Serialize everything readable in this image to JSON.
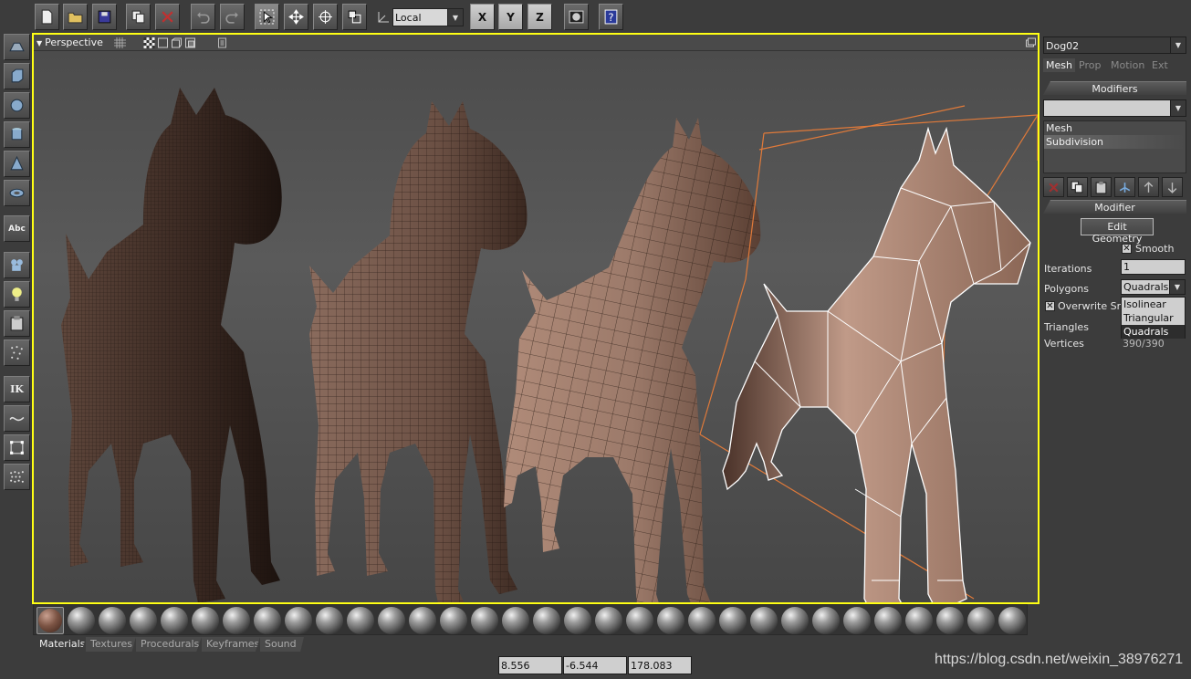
{
  "toolbar": {
    "coord_system": "Local",
    "axes": [
      "X",
      "Y",
      "Z"
    ],
    "buttons": [
      "new-file-icon",
      "open-folder-icon",
      "save-icon",
      "copy-icon",
      "delete-icon",
      "undo-icon",
      "redo-icon",
      "select-icon",
      "move-icon",
      "rotate-icon",
      "scale-icon",
      "render-icon",
      "help-icon"
    ]
  },
  "left_tools": {
    "text_tool": "Abc",
    "ik_tool": "IK"
  },
  "viewport": {
    "title": "Perspective",
    "border_color": "#ffff14"
  },
  "material_library": {
    "tabs": [
      "Materials",
      "Textures",
      "Procedurals",
      "Keyframes",
      "Sound"
    ],
    "active_tab": "Materials",
    "ball_count": 32
  },
  "status": {
    "x": "8.556",
    "y": "-6.544",
    "z": "178.083"
  },
  "watermark": "https://blog.csdn.net/weixin_38976271",
  "panel": {
    "object_name": "Dog02",
    "tabs": [
      "Mesh",
      "Prop",
      "Motion",
      "Ext"
    ],
    "active_tab": "Mesh",
    "modifiers_title": "Modifiers",
    "modifier_stack": [
      "Mesh",
      "Subdivision"
    ],
    "selected_modifier": "Subdivision",
    "modifier_title": "Modifier",
    "edit_geometry_label": "Edit Geometry",
    "smooth_label": "Smooth",
    "iterations_label": "Iterations",
    "iterations_value": "1",
    "polygons_label": "Polygons",
    "polygons_value": "Quadrals",
    "overwrite_label": "Overwrite Sm",
    "triangles_label": "Triangles",
    "vertices_label": "Vertices",
    "vertices_value": "390/390",
    "polygon_options": [
      "Isolinear",
      "Triangular",
      "Quadrals"
    ],
    "polygon_selected": "Quadrals"
  }
}
